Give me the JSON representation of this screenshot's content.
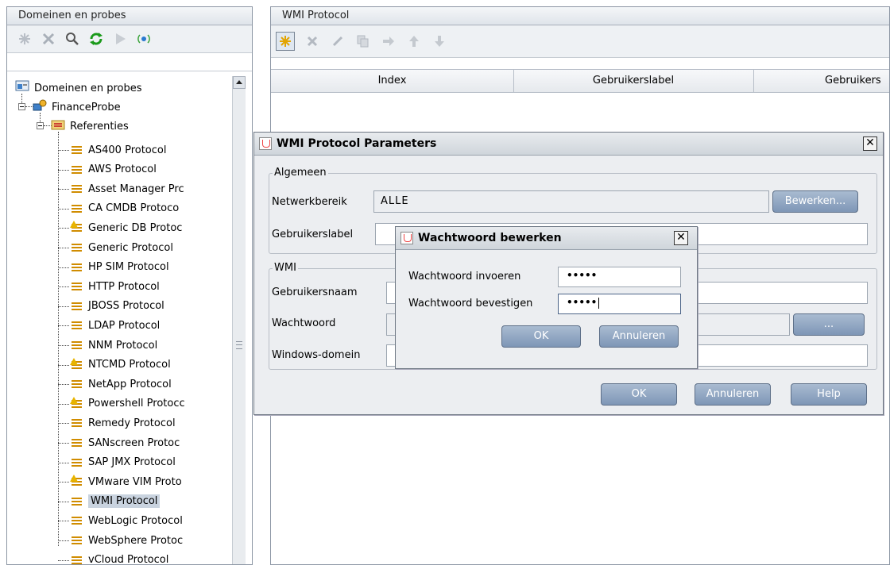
{
  "left": {
    "header": "Domeinen en probes",
    "tree": {
      "root": "Domeinen en probes",
      "probe": "FinanceProbe",
      "folder": "Referenties",
      "items": [
        {
          "label": "AS400 Protocol",
          "warn": false
        },
        {
          "label": "AWS Protocol",
          "warn": false
        },
        {
          "label": "Asset Manager Prc",
          "warn": false
        },
        {
          "label": "CA CMDB Protoco",
          "warn": false
        },
        {
          "label": "Generic DB Protoc",
          "warn": true
        },
        {
          "label": "Generic Protocol",
          "warn": false
        },
        {
          "label": "HP SIM Protocol",
          "warn": false
        },
        {
          "label": "HTTP Protocol",
          "warn": false
        },
        {
          "label": "JBOSS Protocol",
          "warn": false
        },
        {
          "label": "LDAP Protocol",
          "warn": false
        },
        {
          "label": "NNM Protocol",
          "warn": false
        },
        {
          "label": "NTCMD Protocol",
          "warn": true
        },
        {
          "label": "NetApp Protocol",
          "warn": false
        },
        {
          "label": "Powershell Protocc",
          "warn": true
        },
        {
          "label": "Remedy Protocol",
          "warn": false
        },
        {
          "label": "SANscreen Protoc",
          "warn": false
        },
        {
          "label": "SAP JMX Protocol",
          "warn": false
        },
        {
          "label": "VMware VIM Proto",
          "warn": true
        },
        {
          "label": "WMI Protocol",
          "warn": false,
          "selected": true
        },
        {
          "label": "WebLogic Protocol",
          "warn": false
        },
        {
          "label": "WebSphere Protoc",
          "warn": false
        },
        {
          "label": "vCloud Protocol",
          "warn": false
        }
      ]
    }
  },
  "right": {
    "header": "WMI Protocol",
    "columns": [
      "Index",
      "Gebruikerslabel",
      "Gebruikers"
    ]
  },
  "params_dialog": {
    "title": "WMI Protocol Parameters",
    "general_legend": "Algemeen",
    "netwerkbereik_label": "Netwerkbereik",
    "netwerkbereik_value": "ALLE",
    "bewerken_button": "Bewerken...",
    "gebruikerslabel_label": "Gebruikerslabel",
    "wmi_legend": "WMI",
    "gebruikersnaam_label": "Gebruikersnaam",
    "wachtwoord_label": "Wachtwoord",
    "ellipsis_button": "...",
    "windows_domein_label": "Windows-domein",
    "ok_button": "OK",
    "annuleren_button": "Annuleren",
    "help_button": "Help",
    "close_glyph": "✕"
  },
  "pwd_dialog": {
    "title": "Wachtwoord bewerken",
    "invoeren_label": "Wachtwoord invoeren",
    "invoeren_value": "•••••",
    "bevestigen_label": "Wachtwoord bevestigen",
    "bevestigen_value": "•••••",
    "ok_button": "OK",
    "annuleren_button": "Annuleren",
    "close_glyph": "✕"
  },
  "colors": {
    "accent": "#7e96b6",
    "protocol_icon": "#d08c00",
    "warning": "#e8b400",
    "selection": "#c9d3df"
  },
  "icons": [
    "new-icon",
    "delete-icon",
    "search-icon",
    "refresh-icon",
    "run-icon",
    "probe-icon",
    "edit-icon",
    "copy-icon",
    "move-icon",
    "up-arrow-icon",
    "down-arrow-icon"
  ]
}
